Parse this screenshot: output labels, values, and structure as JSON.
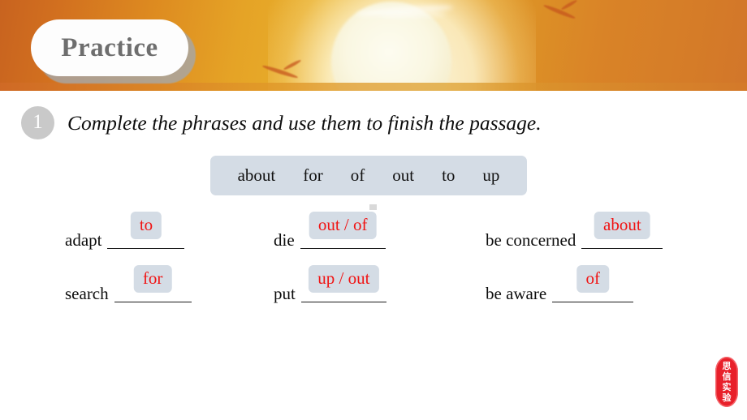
{
  "banner": {
    "title": "Practice",
    "colors": {
      "left": "#c8631f",
      "mid": "#e8b02c",
      "right": "#d2762a",
      "sun": "#fdfcf0"
    }
  },
  "instruction": {
    "step_number": "1",
    "text": "Complete the phrases and use them to finish the passage."
  },
  "word_bank": {
    "words": [
      "about",
      "for",
      "of",
      "out",
      "to",
      "up"
    ],
    "background": "#d4dce5"
  },
  "answers": {
    "color": "#f01414",
    "chip_background": "#d4dce5"
  },
  "phrases": [
    {
      "stem": "adapt",
      "answer": "to",
      "column": 1,
      "row": 1
    },
    {
      "stem": "die",
      "answer": "out / of",
      "column": 2,
      "row": 1
    },
    {
      "stem": "be concerned",
      "answer": "about",
      "column": 3,
      "row": 1
    },
    {
      "stem": "search",
      "answer": "for",
      "column": 1,
      "row": 2
    },
    {
      "stem": "put",
      "answer": "up / out",
      "column": 2,
      "row": 2
    },
    {
      "stem": "be aware",
      "answer": "of",
      "column": 3,
      "row": 2
    }
  ],
  "seal": {
    "characters": [
      "思",
      "信",
      "实",
      "验"
    ],
    "color": "#e8202a"
  }
}
